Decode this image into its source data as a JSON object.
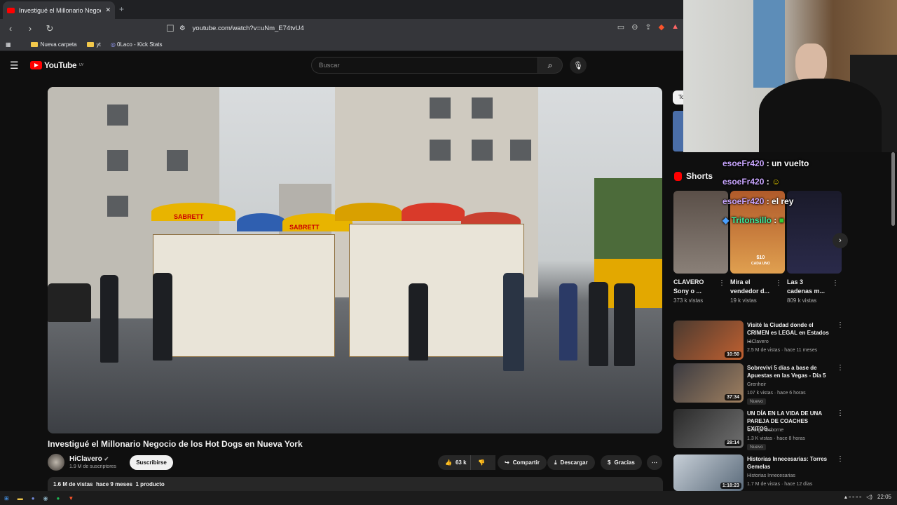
{
  "browser": {
    "tab_title": "Investigué el Millonario Negoc",
    "new_tab_icon": "+",
    "url": "youtube.com/watch?v=uNm_E74tvU4",
    "bookmarks": [
      "Nueva carpeta",
      "yt",
      "0Laco - Kick Stats"
    ]
  },
  "youtube": {
    "logo": "YouTube",
    "country": "UY",
    "search_placeholder": "Buscar"
  },
  "video": {
    "title": "Investigué el Millonario Negocio de los Hot Dogs en Nueva York",
    "channel": "HiClavero",
    "subscribers": "1.9 M de suscriptores",
    "subscribe_label": "Suscribirse",
    "likes": "63 k",
    "share_label": "Compartir",
    "download_label": "Descargar",
    "thanks_label": "Gracias",
    "views": "1.6 M de vistas",
    "age": "hace 9 meses",
    "products": "1 producto"
  },
  "sidebar": {
    "chip_label": "To",
    "shorts_title": "Shorts",
    "shorts": [
      {
        "title1": "CLAVERO",
        "title2": "Sony o ...",
        "views": "373 k vistas"
      },
      {
        "title1": "Mira el",
        "title2": "vendedor d...",
        "views": "19 k vistas"
      },
      {
        "title1": "Las 3",
        "title2": "cadenas m...",
        "views": "809 k vistas"
      }
    ],
    "related": [
      {
        "title": "Visité la Ciudad donde el CRIMEN es LEGAL en Estados ...",
        "channel": "HiClavero",
        "meta": "2.5 M de vistas · hace 11 meses",
        "duration": "10:50",
        "badge": ""
      },
      {
        "title": "Sobreviví 5 días a base de Apuestas en las Vegas - Día 5",
        "channel": "Grenheir",
        "meta": "107 k vistas · hace 6 horas",
        "duration": "37:34",
        "badge": "Nuevo"
      },
      {
        "title": "UN DÍA EN LA VIDA DE UNA PAREJA DE COACHES EXITOS...",
        "channel": "George Osborne",
        "meta": "1.3 K vistas · hace 8 horas",
        "duration": "28:14",
        "badge": "Nuevo"
      },
      {
        "title": "Historias Innecesarias: Torres Gemelas",
        "channel": "Historias Innecesarias",
        "meta": "1.7 M de vistas · hace 12 días",
        "duration": "1:18:23",
        "badge": ""
      }
    ]
  },
  "overlay_chat": [
    {
      "user": "esoeFr420",
      "msg": ": un vuelto"
    },
    {
      "user": "esoeFr420",
      "msg": ":"
    },
    {
      "user": "esoeFr420",
      "msg": ": el rey"
    },
    {
      "user": "Tritonsillo",
      "msg": ":"
    }
  ],
  "video_scene_text": [
    "SABRETT",
    "SABRETT",
    "$10",
    "CADA UNO"
  ],
  "taskbar": {
    "clock": "22:05"
  },
  "colors": {
    "accent": "#ff0000",
    "bg": "#0f0f0f",
    "chip": "#272727"
  }
}
